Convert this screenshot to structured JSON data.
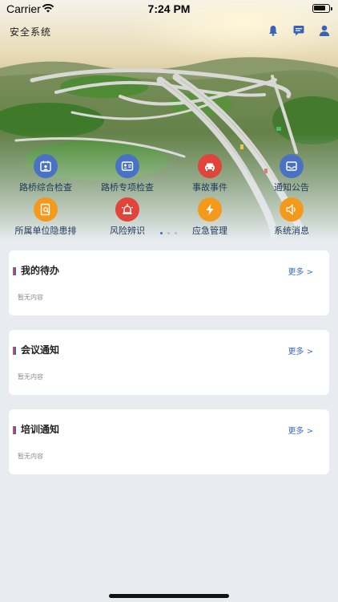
{
  "status_bar": {
    "carrier": "Carrier",
    "time": "7:24 PM"
  },
  "header": {
    "title": "安全系统",
    "icons": [
      "bell-icon",
      "message-icon",
      "user-icon"
    ]
  },
  "menu": {
    "items": [
      {
        "label": "路桥综合检查",
        "icon": "calendar-user-icon",
        "color": "#4a72c4"
      },
      {
        "label": "路桥专项检查",
        "icon": "id-card-icon",
        "color": "#4a72c4"
      },
      {
        "label": "事故事件",
        "icon": "car-icon",
        "color": "#e0443b"
      },
      {
        "label": "通知公告",
        "icon": "inbox-icon",
        "color": "#4a72c4"
      },
      {
        "label": "所属单位隐患排",
        "icon": "document-search-icon",
        "color": "#f39a1c"
      },
      {
        "label": "风险辨识",
        "icon": "alarm-light-icon",
        "color": "#e0443b"
      },
      {
        "label": "应急管理",
        "icon": "lightning-icon",
        "color": "#f39a1c"
      },
      {
        "label": "系统消息",
        "icon": "speaker-icon",
        "color": "#f39a1c"
      }
    ],
    "page_indicator": {
      "pages": 3,
      "current": 1
    }
  },
  "cards": [
    {
      "title": "我的待办",
      "more": "更多 >",
      "empty": "暂无内容"
    },
    {
      "title": "会议通知",
      "more": "更多 >",
      "empty": "暂无内容"
    },
    {
      "title": "培训通知",
      "more": "更多 >",
      "empty": "暂无内容"
    }
  ],
  "colors": {
    "accent": "#3a6bc9",
    "background": "#e8ecf0"
  }
}
